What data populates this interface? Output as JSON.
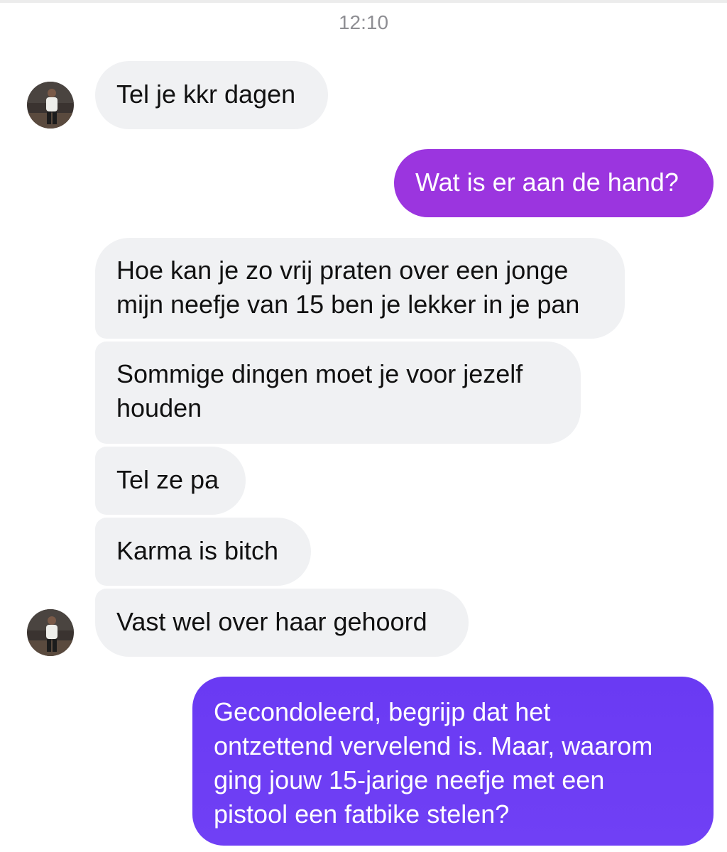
{
  "conversation": {
    "timestamp": "12:10",
    "messages": [
      {
        "id": "b1",
        "direction": "incoming",
        "text": "Tel je kkr dagen"
      },
      {
        "id": "b2",
        "direction": "outgoing",
        "text": "Wat is er aan de hand?"
      },
      {
        "id": "b3",
        "direction": "incoming",
        "text": "Hoe kan je zo vrij praten over een jonge\nmijn neefje van 15 ben je lekker in je pan"
      },
      {
        "id": "b4",
        "direction": "incoming",
        "text": "Sommige dingen moet je voor jezelf\nhouden"
      },
      {
        "id": "b5",
        "direction": "incoming",
        "text": "Tel ze pa"
      },
      {
        "id": "b6",
        "direction": "incoming",
        "text": "Karma is bitch"
      },
      {
        "id": "b7",
        "direction": "incoming",
        "text": "Vast wel over haar gehoord"
      },
      {
        "id": "b8",
        "direction": "outgoing",
        "text": "Gecondoleerd, begrijp dat het\nontzettend vervelend is. Maar, waarom\nging jouw 15-jarige neefje met een\npistool een fatbike stelen?"
      }
    ]
  },
  "colors": {
    "incoming_bubble": "#f0f1f3",
    "outgoing_bubble_1": "#9b35df",
    "outgoing_bubble_2": "#6a3af3",
    "timestamp_text": "#8e8e93"
  },
  "icons": {
    "avatar": "contact-avatar-photo"
  }
}
